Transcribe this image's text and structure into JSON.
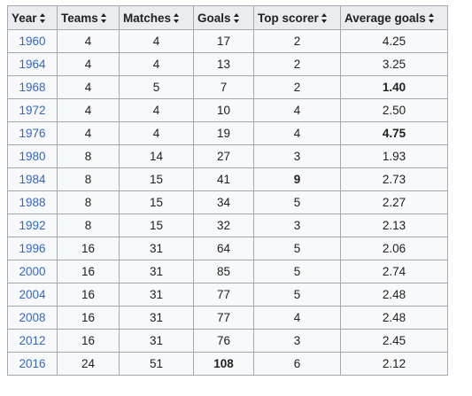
{
  "table": {
    "headers": [
      "Year",
      "Teams",
      "Matches",
      "Goals",
      "Top scorer",
      "Average goals"
    ],
    "rows": [
      {
        "year": "1960",
        "teams": "4",
        "matches": "4",
        "goals": "17",
        "top": "2",
        "avg": "4.25"
      },
      {
        "year": "1964",
        "teams": "4",
        "matches": "4",
        "goals": "13",
        "top": "2",
        "avg": "3.25"
      },
      {
        "year": "1968",
        "teams": "4",
        "matches": "5",
        "goals": "7",
        "top": "2",
        "avg": "1.40"
      },
      {
        "year": "1972",
        "teams": "4",
        "matches": "4",
        "goals": "10",
        "top": "4",
        "avg": "2.50"
      },
      {
        "year": "1976",
        "teams": "4",
        "matches": "4",
        "goals": "19",
        "top": "4",
        "avg": "4.75"
      },
      {
        "year": "1980",
        "teams": "8",
        "matches": "14",
        "goals": "27",
        "top": "3",
        "avg": "1.93"
      },
      {
        "year": "1984",
        "teams": "8",
        "matches": "15",
        "goals": "41",
        "top": "9",
        "avg": "2.73"
      },
      {
        "year": "1988",
        "teams": "8",
        "matches": "15",
        "goals": "34",
        "top": "5",
        "avg": "2.27"
      },
      {
        "year": "1992",
        "teams": "8",
        "matches": "15",
        "goals": "32",
        "top": "3",
        "avg": "2.13"
      },
      {
        "year": "1996",
        "teams": "16",
        "matches": "31",
        "goals": "64",
        "top": "5",
        "avg": "2.06"
      },
      {
        "year": "2000",
        "teams": "16",
        "matches": "31",
        "goals": "85",
        "top": "5",
        "avg": "2.74"
      },
      {
        "year": "2004",
        "teams": "16",
        "matches": "31",
        "goals": "77",
        "top": "5",
        "avg": "2.48"
      },
      {
        "year": "2008",
        "teams": "16",
        "matches": "31",
        "goals": "77",
        "top": "4",
        "avg": "2.48"
      },
      {
        "year": "2012",
        "teams": "16",
        "matches": "31",
        "goals": "76",
        "top": "3",
        "avg": "2.45"
      },
      {
        "year": "2016",
        "teams": "24",
        "matches": "51",
        "goals": "108",
        "top": "6",
        "avg": "2.12"
      }
    ],
    "bold_cells": {
      "top": [
        "1984"
      ],
      "avg": [
        "1968",
        "1976"
      ],
      "goals": [
        "2016"
      ]
    }
  },
  "icons": {
    "sort": "sort-icon"
  },
  "colors": {
    "link": "#3366cc",
    "header_bg": "#eaecf0",
    "cell_bg": "#f8f9fa",
    "border": "#a2a9b1"
  }
}
